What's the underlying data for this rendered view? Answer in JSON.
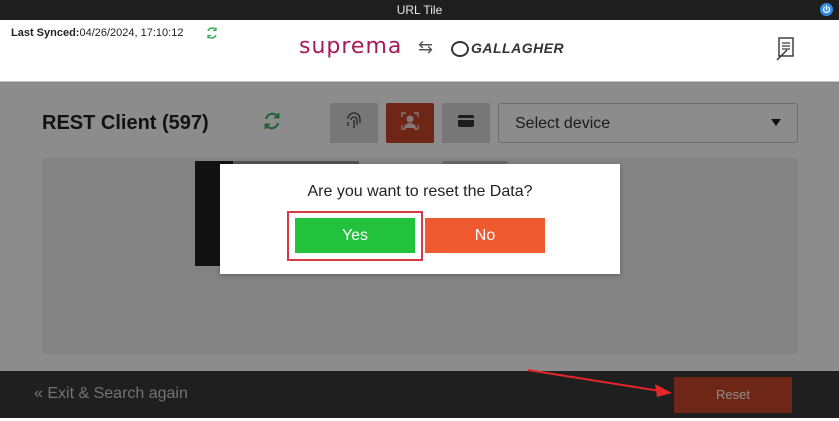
{
  "window": {
    "title": "URL Tile"
  },
  "header": {
    "sync_label": "Last Synced:",
    "sync_value": "04/26/2024, 17:10:12",
    "logo_suprema": "suprema",
    "logo_arrows": "⇆",
    "logo_gallagher": "GALLAGHER"
  },
  "main": {
    "client_title": "REST Client (597)",
    "device_select": {
      "value": "Select device"
    }
  },
  "footer": {
    "exit_label": "Exit & Search again",
    "exit_chevron": "«",
    "reset_label": "Reset"
  },
  "dialog": {
    "question": "Are you want to reset the Data?",
    "yes_label": "Yes",
    "no_label": "No"
  },
  "icons": {
    "sync": "sync-icon",
    "refresh": "refresh-icon",
    "fingerprint": "fingerprint-icon",
    "face": "face-icon",
    "card": "card-icon",
    "document": "document-icon",
    "power": "power-icon"
  },
  "colors": {
    "accent_red": "#c9452b",
    "yes_green": "#22c23c",
    "no_orange": "#ef5a31",
    "highlight": "#d63a42",
    "brand_suprema": "#a6195a"
  }
}
